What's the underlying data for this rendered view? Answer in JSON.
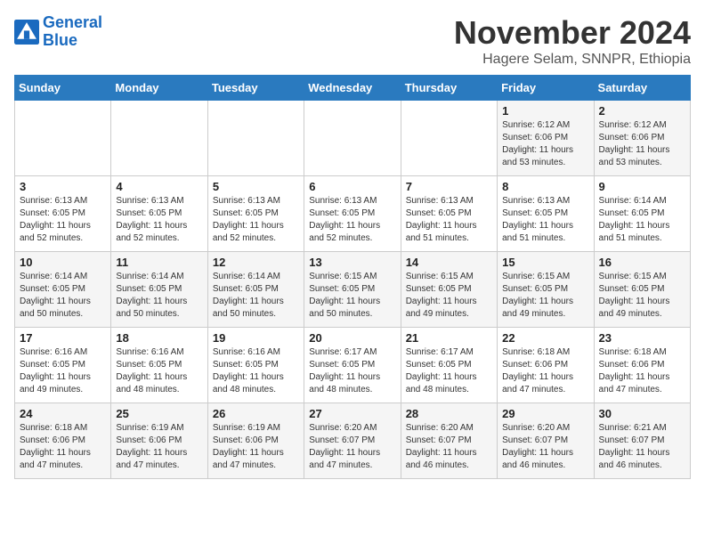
{
  "header": {
    "logo_line1": "General",
    "logo_line2": "Blue",
    "month_year": "November 2024",
    "location": "Hagere Selam, SNNPR, Ethiopia"
  },
  "days_of_week": [
    "Sunday",
    "Monday",
    "Tuesday",
    "Wednesday",
    "Thursday",
    "Friday",
    "Saturday"
  ],
  "weeks": [
    [
      {
        "day": "",
        "text": ""
      },
      {
        "day": "",
        "text": ""
      },
      {
        "day": "",
        "text": ""
      },
      {
        "day": "",
        "text": ""
      },
      {
        "day": "",
        "text": ""
      },
      {
        "day": "1",
        "text": "Sunrise: 6:12 AM\nSunset: 6:06 PM\nDaylight: 11 hours\nand 53 minutes."
      },
      {
        "day": "2",
        "text": "Sunrise: 6:12 AM\nSunset: 6:06 PM\nDaylight: 11 hours\nand 53 minutes."
      }
    ],
    [
      {
        "day": "3",
        "text": "Sunrise: 6:13 AM\nSunset: 6:05 PM\nDaylight: 11 hours\nand 52 minutes."
      },
      {
        "day": "4",
        "text": "Sunrise: 6:13 AM\nSunset: 6:05 PM\nDaylight: 11 hours\nand 52 minutes."
      },
      {
        "day": "5",
        "text": "Sunrise: 6:13 AM\nSunset: 6:05 PM\nDaylight: 11 hours\nand 52 minutes."
      },
      {
        "day": "6",
        "text": "Sunrise: 6:13 AM\nSunset: 6:05 PM\nDaylight: 11 hours\nand 52 minutes."
      },
      {
        "day": "7",
        "text": "Sunrise: 6:13 AM\nSunset: 6:05 PM\nDaylight: 11 hours\nand 51 minutes."
      },
      {
        "day": "8",
        "text": "Sunrise: 6:13 AM\nSunset: 6:05 PM\nDaylight: 11 hours\nand 51 minutes."
      },
      {
        "day": "9",
        "text": "Sunrise: 6:14 AM\nSunset: 6:05 PM\nDaylight: 11 hours\nand 51 minutes."
      }
    ],
    [
      {
        "day": "10",
        "text": "Sunrise: 6:14 AM\nSunset: 6:05 PM\nDaylight: 11 hours\nand 50 minutes."
      },
      {
        "day": "11",
        "text": "Sunrise: 6:14 AM\nSunset: 6:05 PM\nDaylight: 11 hours\nand 50 minutes."
      },
      {
        "day": "12",
        "text": "Sunrise: 6:14 AM\nSunset: 6:05 PM\nDaylight: 11 hours\nand 50 minutes."
      },
      {
        "day": "13",
        "text": "Sunrise: 6:15 AM\nSunset: 6:05 PM\nDaylight: 11 hours\nand 50 minutes."
      },
      {
        "day": "14",
        "text": "Sunrise: 6:15 AM\nSunset: 6:05 PM\nDaylight: 11 hours\nand 49 minutes."
      },
      {
        "day": "15",
        "text": "Sunrise: 6:15 AM\nSunset: 6:05 PM\nDaylight: 11 hours\nand 49 minutes."
      },
      {
        "day": "16",
        "text": "Sunrise: 6:15 AM\nSunset: 6:05 PM\nDaylight: 11 hours\nand 49 minutes."
      }
    ],
    [
      {
        "day": "17",
        "text": "Sunrise: 6:16 AM\nSunset: 6:05 PM\nDaylight: 11 hours\nand 49 minutes."
      },
      {
        "day": "18",
        "text": "Sunrise: 6:16 AM\nSunset: 6:05 PM\nDaylight: 11 hours\nand 48 minutes."
      },
      {
        "day": "19",
        "text": "Sunrise: 6:16 AM\nSunset: 6:05 PM\nDaylight: 11 hours\nand 48 minutes."
      },
      {
        "day": "20",
        "text": "Sunrise: 6:17 AM\nSunset: 6:05 PM\nDaylight: 11 hours\nand 48 minutes."
      },
      {
        "day": "21",
        "text": "Sunrise: 6:17 AM\nSunset: 6:05 PM\nDaylight: 11 hours\nand 48 minutes."
      },
      {
        "day": "22",
        "text": "Sunrise: 6:18 AM\nSunset: 6:06 PM\nDaylight: 11 hours\nand 47 minutes."
      },
      {
        "day": "23",
        "text": "Sunrise: 6:18 AM\nSunset: 6:06 PM\nDaylight: 11 hours\nand 47 minutes."
      }
    ],
    [
      {
        "day": "24",
        "text": "Sunrise: 6:18 AM\nSunset: 6:06 PM\nDaylight: 11 hours\nand 47 minutes."
      },
      {
        "day": "25",
        "text": "Sunrise: 6:19 AM\nSunset: 6:06 PM\nDaylight: 11 hours\nand 47 minutes."
      },
      {
        "day": "26",
        "text": "Sunrise: 6:19 AM\nSunset: 6:06 PM\nDaylight: 11 hours\nand 47 minutes."
      },
      {
        "day": "27",
        "text": "Sunrise: 6:20 AM\nSunset: 6:07 PM\nDaylight: 11 hours\nand 47 minutes."
      },
      {
        "day": "28",
        "text": "Sunrise: 6:20 AM\nSunset: 6:07 PM\nDaylight: 11 hours\nand 46 minutes."
      },
      {
        "day": "29",
        "text": "Sunrise: 6:20 AM\nSunset: 6:07 PM\nDaylight: 11 hours\nand 46 minutes."
      },
      {
        "day": "30",
        "text": "Sunrise: 6:21 AM\nSunset: 6:07 PM\nDaylight: 11 hours\nand 46 minutes."
      }
    ]
  ]
}
